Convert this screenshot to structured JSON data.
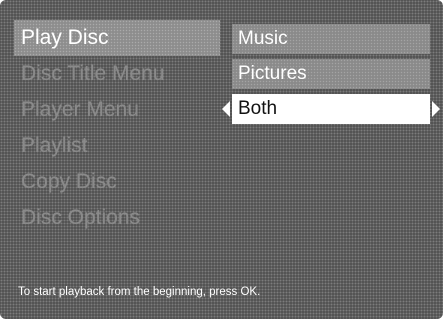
{
  "main_menu": {
    "items": [
      {
        "label": "Play Disc"
      },
      {
        "label": "Disc Title Menu"
      },
      {
        "label": "Player Menu"
      },
      {
        "label": "Playlist"
      },
      {
        "label": "Copy Disc"
      },
      {
        "label": "Disc Options"
      }
    ],
    "active_index": 0
  },
  "sub_menu": {
    "items": [
      {
        "label": "Music"
      },
      {
        "label": "Pictures"
      },
      {
        "label": "Both"
      }
    ],
    "selected_index": 2
  },
  "hint_text": "To start playback from the beginning, press OK."
}
